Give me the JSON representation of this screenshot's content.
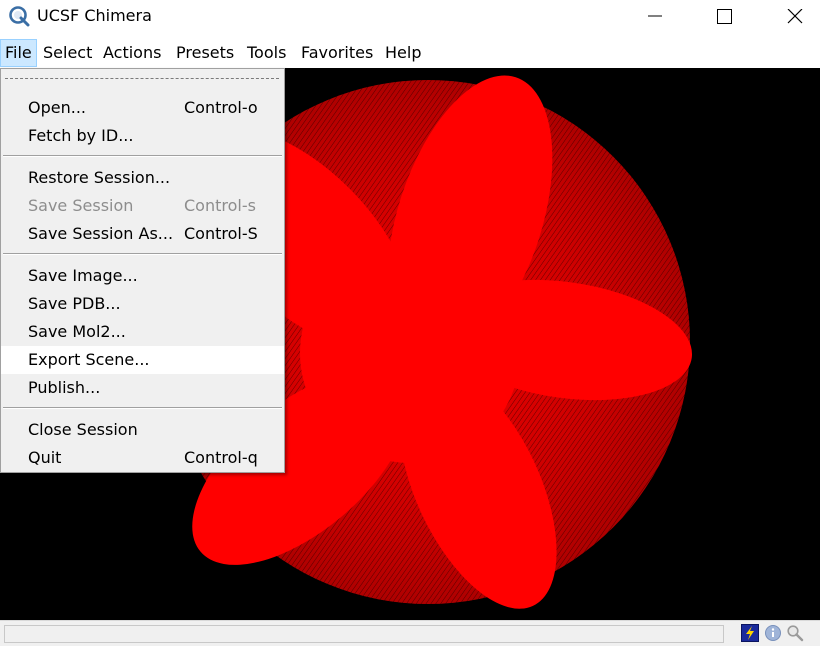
{
  "window": {
    "title": "UCSF Chimera",
    "app_icon": "chimera-logo-icon",
    "controls": [
      "minimize-icon",
      "maximize-icon",
      "close-icon"
    ]
  },
  "menubar": {
    "items": [
      {
        "label": "File",
        "active": true
      },
      {
        "label": "Select"
      },
      {
        "label": "Actions"
      },
      {
        "label": "Presets"
      },
      {
        "label": "Tools"
      },
      {
        "label": "Favorites"
      },
      {
        "label": "Help"
      }
    ]
  },
  "file_menu": {
    "items": [
      {
        "label": "Open...",
        "accel": "Control-o"
      },
      {
        "label": "Fetch by ID...",
        "accel": ""
      },
      {
        "label": "Restore Session...",
        "accel": ""
      },
      {
        "label": "Save Session",
        "accel": "Control-s",
        "disabled": true
      },
      {
        "label": "Save Session As...",
        "accel": "Control-S"
      },
      {
        "label": "Save Image...",
        "accel": ""
      },
      {
        "label": "Save PDB...",
        "accel": ""
      },
      {
        "label": "Save Mol2...",
        "accel": ""
      },
      {
        "label": "Export Scene...",
        "accel": "",
        "highlighted": true
      },
      {
        "label": "Publish...",
        "accel": ""
      },
      {
        "label": "Close Session",
        "accel": ""
      },
      {
        "label": "Quit",
        "accel": "Control-q"
      }
    ]
  },
  "colors": {
    "viewport_background": "#000000",
    "surface": "#ff0000",
    "menu_background": "#f0f0f0",
    "menu_highlight": "#ffffff",
    "active_menu": "#cce8ff",
    "disabled_text": "#8d8d8d"
  },
  "statusbar": {
    "text": "",
    "icons": [
      "lightning-icon",
      "info-icon",
      "magnifier-icon"
    ]
  }
}
